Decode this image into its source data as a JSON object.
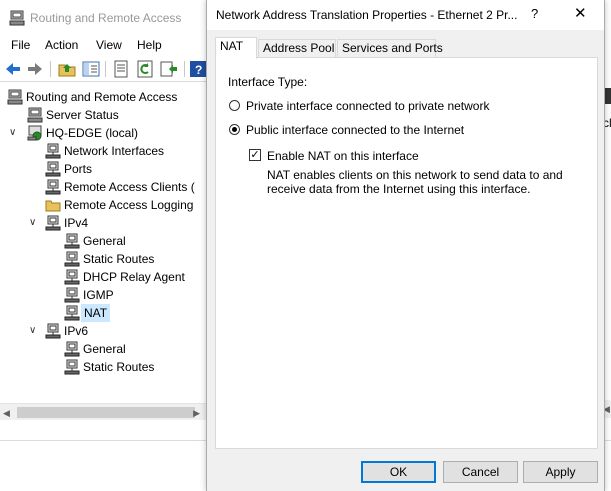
{
  "mmc": {
    "title": "Routing and Remote Access",
    "menu": [
      "File",
      "Action",
      "View",
      "Help"
    ],
    "tree": [
      {
        "label": "Routing and Remote Access",
        "icon": "server-icon"
      },
      {
        "label": "Server Status",
        "icon": "server-icon"
      },
      {
        "label": "HQ-EDGE (local)",
        "icon": "server-icon"
      },
      {
        "label": "Network Interfaces",
        "icon": "network-icon"
      },
      {
        "label": "Ports",
        "icon": "network-icon"
      },
      {
        "label": "Remote Access Clients (",
        "icon": "network-icon"
      },
      {
        "label": "Remote Access Logging",
        "icon": "folder-icon"
      },
      {
        "label": "IPv4",
        "icon": "network-icon"
      },
      {
        "label": "General",
        "icon": "network-icon"
      },
      {
        "label": "Static Routes",
        "icon": "network-icon"
      },
      {
        "label": "DHCP Relay Agent",
        "icon": "network-icon"
      },
      {
        "label": "IGMP",
        "icon": "network-icon"
      },
      {
        "label": "NAT",
        "icon": "network-icon"
      },
      {
        "label": "IPv6",
        "icon": "network-icon"
      },
      {
        "label": "General",
        "icon": "network-icon"
      },
      {
        "label": "Static Routes",
        "icon": "network-icon"
      }
    ],
    "right_edge_text": "cl"
  },
  "dialog": {
    "title": "Network Address Translation Properties - Ethernet 2 Pr...",
    "help_glyph": "?",
    "close_glyph": "✕",
    "tabs": [
      "NAT",
      "Address Pool",
      "Services and Ports"
    ],
    "interface_type_label": "Interface Type:",
    "radio_private": "Private interface connected to private network",
    "radio_public": "Public interface connected to the Internet",
    "checkbox_label": "Enable NAT on this interface",
    "checkbox_mark": "✓",
    "description": "NAT enables clients on this network to send data to and receive data from the Internet using this interface.",
    "buttons": {
      "ok": "OK",
      "cancel": "Cancel",
      "apply": "Apply"
    }
  },
  "colors": {
    "accent": "#0078d7",
    "selection": "#cce8ff"
  }
}
